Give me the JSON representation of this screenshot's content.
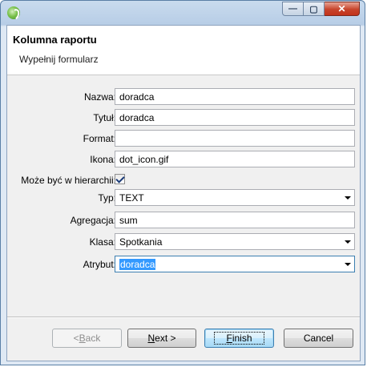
{
  "window": {
    "controls": {
      "minimize": "—",
      "maximize": "▢",
      "close": "✕"
    }
  },
  "header": {
    "title": "Kolumna raportu",
    "subtitle": "Wypełnij formularz"
  },
  "form": {
    "name_label": "Nazwa:",
    "name_value": "doradca",
    "title_label": "Tytuł:",
    "title_value": "doradca",
    "format_label": "Format:",
    "format_value": "",
    "icon_label": "Ikona:",
    "icon_value": "dot_icon.gif",
    "hierarchy_label": "Może być w hierarchii:",
    "hierarchy_checked": true,
    "type_label": "Typ:",
    "type_value": "TEXT",
    "aggregation_label": "Agregacja:",
    "aggregation_value": "sum",
    "class_label": "Klasa:",
    "class_value": "Spotkania",
    "attribute_label": "Atrybut:",
    "attribute_value": "doradca"
  },
  "buttons": {
    "back_prefix": "< ",
    "back_mnemonic": "B",
    "back_rest": "ack",
    "next_mnemonic": "N",
    "next_rest": "ext >",
    "finish_mnemonic": "F",
    "finish_rest": "inish",
    "cancel_label": "Cancel"
  }
}
